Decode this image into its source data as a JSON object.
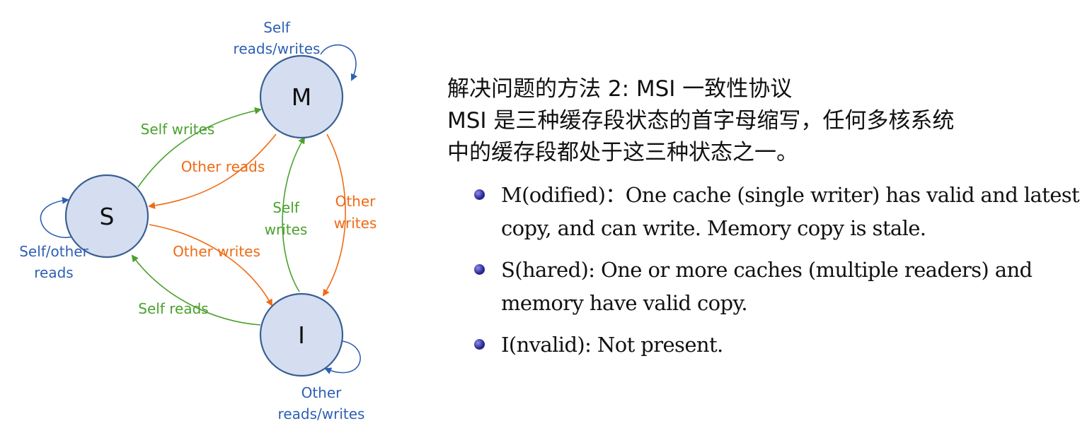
{
  "diagram": {
    "nodes": {
      "m": "M",
      "s": "S",
      "i": "I"
    },
    "edge_labels": {
      "m_self_line1": "Self",
      "m_self_line2": "reads/writes",
      "s_self_line1": "Self/other",
      "s_self_line2": "reads",
      "i_self_line1": "Other",
      "i_self_line2": "reads/writes",
      "s_to_m": "Self writes",
      "m_to_s": "Other reads",
      "i_to_m_line1": "Self",
      "i_to_m_line2": "writes",
      "m_to_i_line1": "Other",
      "m_to_i_line2": "writes",
      "s_to_i": "Other writes",
      "i_to_s": "Self reads"
    },
    "colors": {
      "self_loop": "#2e5fb5",
      "self_transition": "#4ba12d",
      "other_transition": "#f06a14",
      "node_fill": "#d4def0",
      "node_stroke": "#3a5f94"
    }
  },
  "panel": {
    "heading_lines": [
      "解决问题的方法 2: MSI 一致性协议",
      "MSI 是三种缓存段状态的首字母缩写，任何多核系统",
      "中的缓存段都处于这三种状态之一。"
    ],
    "bullets": [
      "M(odified)：One cache (single writer) has valid and latest copy, and can write. Memory copy is stale.",
      "S(hared): One or more caches (multiple readers) and memory have valid copy.",
      "I(nvalid): Not present."
    ],
    "bullet_color": "#2c2c99"
  }
}
